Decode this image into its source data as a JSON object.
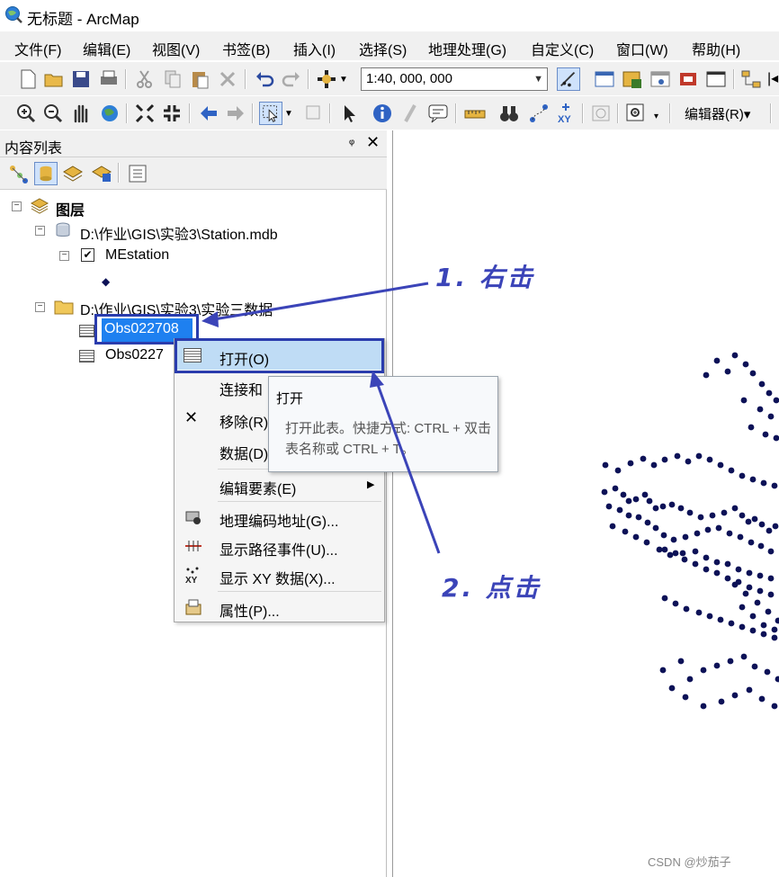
{
  "window": {
    "title": "无标题 - ArcMap"
  },
  "menu": [
    "文件(F)",
    "编辑(E)",
    "视图(V)",
    "书签(B)",
    "插入(I)",
    "选择(S)",
    "地理处理(G)",
    "自定义(C)",
    "窗口(W)",
    "帮助(H)"
  ],
  "toolbar": {
    "scale_value": "1:40, 000, 000",
    "editor_label": "编辑器(R)▾"
  },
  "toc": {
    "title": "内容列表",
    "pin": "ᵠ",
    "close": "✕",
    "layers_label": "图层",
    "station_db": "D:\\作业\\GIS\\实验3\\Station.mdb",
    "mestation": "MEstation",
    "folder": "D:\\作业\\GIS\\实验3\\实验三数据",
    "table1": "Obs022708",
    "table2": "Obs0227"
  },
  "context_menu": {
    "items": [
      "打开(O)",
      "连接和关联",
      "移除(R)",
      "数据(D)",
      "编辑要素(E)",
      "地理编码地址(G)...",
      "显示路径事件(U)...",
      "显示 XY 数据(X)...",
      "属性(P)..."
    ],
    "item_visible_text": [
      "打开(O)",
      "连接和",
      "移除(R)",
      "数据(D)",
      "编辑要素(E)",
      "地理编码地址(G)...",
      "显示路径事件(U)...",
      "显示 XY 数据(X)...",
      "属性(P)..."
    ]
  },
  "tooltip": {
    "title": "打开",
    "body": "打开此表。快捷方式: CTRL + 双击表名称或 CTRL + T。"
  },
  "annotations": {
    "step1": "1. 右击",
    "step2": "2. 点击",
    "color": "#3b44b8"
  },
  "watermark": "CSDN @炒茄子",
  "colors": {
    "selection": "#1e80f0",
    "highlight_box": "#2a3cad",
    "map_point": "#0d1257"
  }
}
